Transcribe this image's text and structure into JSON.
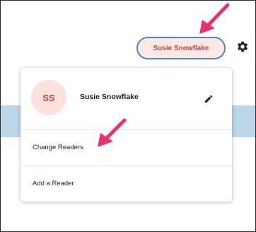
{
  "header": {
    "reader_name": "Susie Snowflake",
    "icons": {
      "settings": "gear-icon"
    }
  },
  "menu": {
    "avatar_initials": "SS",
    "profile_name": "Susie Snowflake",
    "icons": {
      "edit": "pencil-icon"
    },
    "items": [
      {
        "label": "Change Readers"
      },
      {
        "label": "Add a Reader"
      }
    ]
  },
  "colors": {
    "accent_text": "#b7474a",
    "pill_background": "#fde8e3",
    "pill_border": "#4d86c4",
    "annotation_arrow": "#e8326e",
    "band": "#bcd6ea"
  }
}
